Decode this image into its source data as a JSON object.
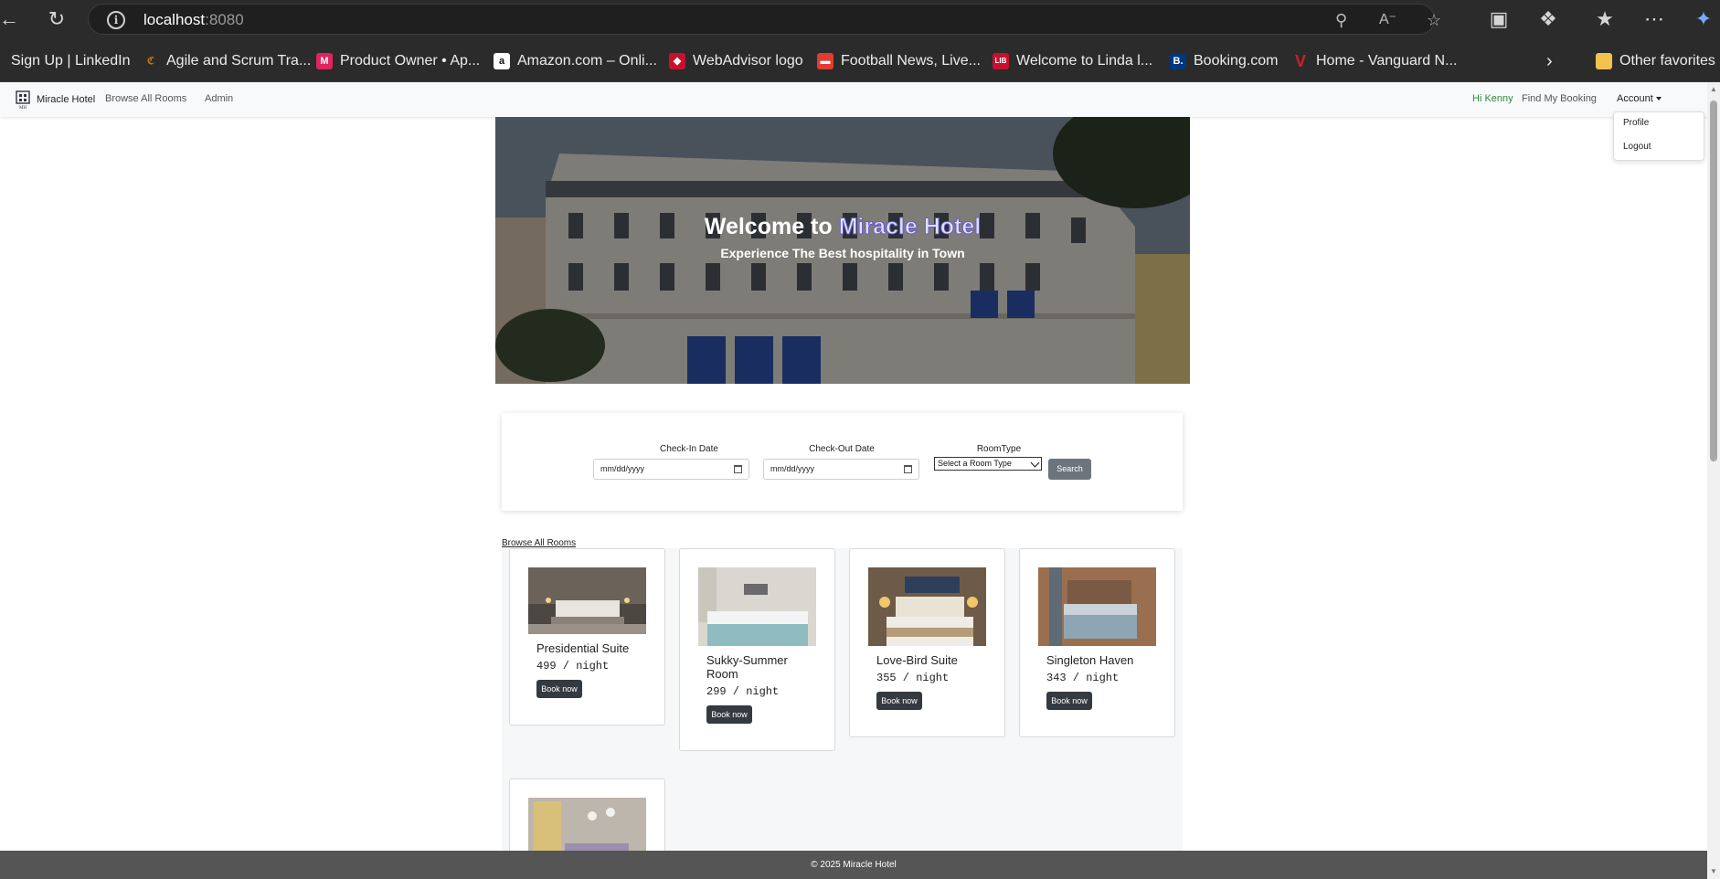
{
  "browser": {
    "url_host": "localhost",
    "url_port": ":8080",
    "bookmarks": [
      {
        "label": "Sign Up | LinkedIn",
        "icon": "linkedin-icon",
        "color": "#2b2b2b"
      },
      {
        "label": "Agile and Scrum Tra...",
        "icon": "agile-icon",
        "color": "#c47a1a"
      },
      {
        "label": "Product Owner • Ap...",
        "icon": "m-icon",
        "color": "#e0245e"
      },
      {
        "label": "Amazon.com – Onli...",
        "icon": "amazon-icon",
        "color": "#ffffff"
      },
      {
        "label": "WebAdvisor logo",
        "icon": "shield-icon",
        "color": "#c8102e"
      },
      {
        "label": "Football News, Live...",
        "icon": "football-icon",
        "color": "#e03c31"
      },
      {
        "label": "Welcome to Linda l...",
        "icon": "lib-icon",
        "color": "#c8102e"
      },
      {
        "label": "Booking.com",
        "icon": "booking-icon",
        "color": "#003580"
      },
      {
        "label": "Home - Vanguard N...",
        "icon": "vanguard-icon",
        "color": "#96151d"
      }
    ],
    "other_favorites": "Other favorites"
  },
  "navbar": {
    "brand": "Miracle Hotel",
    "logo_text": "MH",
    "browse": "Browse All Rooms",
    "admin": "Admin",
    "greeting": "Hi Kenny",
    "find_booking": "Find My Booking",
    "account": "Account",
    "dropdown": {
      "profile": "Profile",
      "logout": "Logout"
    }
  },
  "hero": {
    "title_prefix": "Welcome to ",
    "title_accent": "Miracle Hotel",
    "subtitle": "Experience The Best hospitality in Town"
  },
  "search": {
    "checkin_label": "Check-In Date",
    "checkout_label": "Check-Out Date",
    "roomtype_label": "RoomType",
    "date_placeholder": "mm/dd/yyyy",
    "roomtype_value": "Select a Room Type",
    "button": "Search"
  },
  "rooms": {
    "browse_link": "Browse All Rooms",
    "items": [
      {
        "name": "Presidential Suite",
        "price": "499 / night",
        "button": "Book now"
      },
      {
        "name": "Sukky-Summer Room",
        "price": "299 / night",
        "button": "Book now"
      },
      {
        "name": "Love-Bird Suite",
        "price": "355 / night",
        "button": "Book now"
      },
      {
        "name": "Singleton Haven",
        "price": "343 / night",
        "button": "Book now"
      }
    ]
  },
  "footer": {
    "text": "© 2025 Miracle Hotel"
  },
  "colors": {
    "greeting": "#2e8b3e",
    "book_button": "#343a40",
    "search_button": "#6c757d",
    "footer": "#555555"
  }
}
